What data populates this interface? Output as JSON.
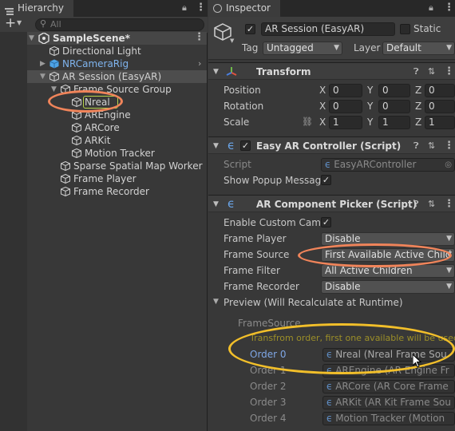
{
  "hierarchy": {
    "tab_label": "Hierarchy",
    "search_placeholder": "All",
    "items": [
      {
        "label": "SampleScene*"
      },
      {
        "label": "Directional Light"
      },
      {
        "label": "NRCameraRig"
      },
      {
        "label": "AR Session (EasyAR)"
      },
      {
        "label": "Frame Source Group"
      },
      {
        "label": "Nreal"
      },
      {
        "label": "AREngine"
      },
      {
        "label": "ARCore"
      },
      {
        "label": "ARKit"
      },
      {
        "label": "Motion Tracker"
      },
      {
        "label": "Sparse Spatial Map Worker"
      },
      {
        "label": "Frame Player"
      },
      {
        "label": "Frame Recorder"
      }
    ]
  },
  "inspector": {
    "tab_label": "Inspector",
    "object_name": "AR Session (EasyAR)",
    "static_label": "Static",
    "tag_label": "Tag",
    "tag_value": "Untagged",
    "layer_label": "Layer",
    "layer_value": "Default",
    "transform": {
      "title": "Transform",
      "position_label": "Position",
      "rotation_label": "Rotation",
      "scale_label": "Scale",
      "x": "X",
      "y": "Y",
      "z": "Z",
      "position": [
        "0",
        "0",
        "0"
      ],
      "rotation": [
        "0",
        "0",
        "0"
      ],
      "scale": [
        "1",
        "1",
        "1"
      ]
    },
    "easy_ar_controller": {
      "title": "Easy AR Controller (Script)",
      "script_label": "Script",
      "script_value": "EasyARController",
      "popup_label": "Show Popup Messag"
    },
    "picker": {
      "title": "AR Component Picker (Script)",
      "enable_camera_label": "Enable Custom Came",
      "frame_player_label": "Frame Player",
      "frame_player_value": "Disable",
      "frame_source_label": "Frame Source",
      "frame_source_value": "First Available Active Child",
      "frame_filter_label": "Frame Filter",
      "frame_filter_value": "All Active Children",
      "frame_recorder_label": "Frame Recorder",
      "frame_recorder_value": "Disable",
      "preview_label": "Preview (Will Recalculate at Runtime)",
      "frame_source_group": "FrameSource",
      "transform_order_note": "Transfrom order, first one available will be used",
      "orders": [
        {
          "label": "Order 0",
          "value": "Nreal (Nreal Frame Sou"
        },
        {
          "label": "Order 1",
          "value": "AREngine (AR Engine Fr"
        },
        {
          "label": "Order 2",
          "value": "ARCore (AR Core Frame"
        },
        {
          "label": "Order 3",
          "value": "ARKit (AR Kit Frame Sou"
        },
        {
          "label": "Order 4",
          "value": "Motion Tracker (Motion"
        }
      ]
    }
  },
  "colors": {
    "highlight_orange": "#f0845a",
    "highlight_yellow": "#f2bf2a",
    "highlight_green": "#b7d24a",
    "link_blue": "#7fa7e6"
  }
}
